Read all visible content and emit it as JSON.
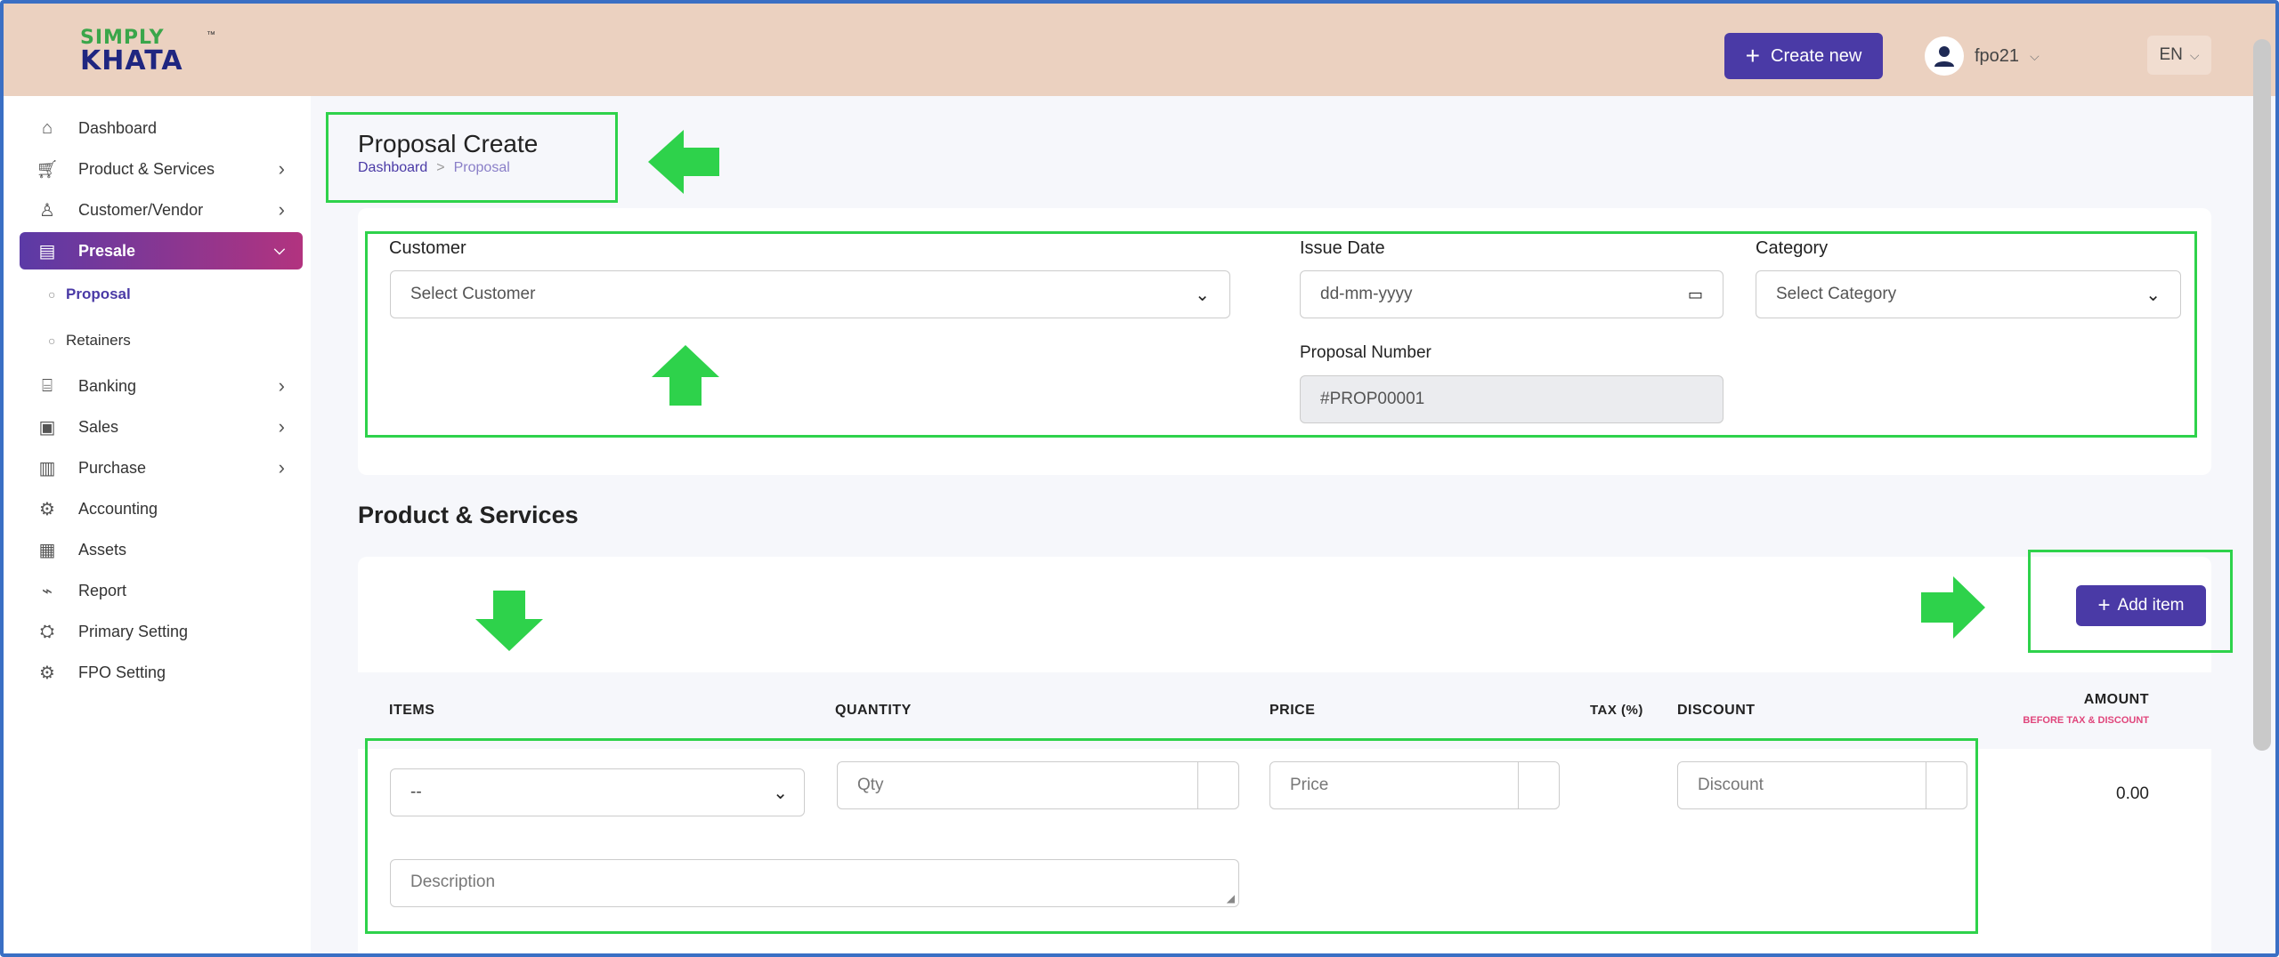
{
  "colors": {
    "header_bg": "#ebd1c0",
    "primary": "#4a3aa6",
    "active_gradient_start": "#5b3aa6",
    "active_gradient_end": "#b2337f",
    "annotation": "#2ed24b",
    "amount_sub": "#e0457b"
  },
  "brand": {
    "line1": "SIMPLY",
    "line2": "KHATA",
    "tm": "™"
  },
  "header": {
    "create_label": "Create new",
    "user_name": "fpo21",
    "language": "EN"
  },
  "sidebar": {
    "items": [
      {
        "label": "Dashboard",
        "icon": "home-icon",
        "has_arrow": false
      },
      {
        "label": "Product & Services",
        "icon": "cart-icon",
        "has_arrow": true
      },
      {
        "label": "Customer/Vendor",
        "icon": "user-add-icon",
        "has_arrow": true
      },
      {
        "label": "Presale",
        "icon": "presale-icon",
        "has_arrow": true,
        "active": true
      },
      {
        "label": "Banking",
        "icon": "bank-icon",
        "has_arrow": true
      },
      {
        "label": "Sales",
        "icon": "sales-icon",
        "has_arrow": true
      },
      {
        "label": "Purchase",
        "icon": "purchase-icon",
        "has_arrow": true
      },
      {
        "label": "Accounting",
        "icon": "accounting-icon",
        "has_arrow": false
      },
      {
        "label": "Assets",
        "icon": "assets-icon",
        "has_arrow": false
      },
      {
        "label": "Report",
        "icon": "report-icon",
        "has_arrow": false
      },
      {
        "label": "Primary Setting",
        "icon": "setting-icon",
        "has_arrow": false
      },
      {
        "label": "FPO Setting",
        "icon": "gear-icon",
        "has_arrow": false
      }
    ],
    "sub_items": [
      {
        "label": "Proposal",
        "current": true
      },
      {
        "label": "Retainers",
        "current": false
      }
    ]
  },
  "page": {
    "title": "Proposal Create",
    "breadcrumb": {
      "home": "Dashboard",
      "separator": ">",
      "current": "Proposal"
    }
  },
  "form": {
    "customer_label": "Customer",
    "customer_value": "Select Customer",
    "issue_date_label": "Issue Date",
    "issue_date_placeholder": "dd-mm-yyyy",
    "category_label": "Category",
    "category_value": "Select Category",
    "proposal_number_label": "Proposal Number",
    "proposal_number_value": "#PROP00001"
  },
  "products": {
    "section_title": "Product & Services",
    "add_item_label": "Add item",
    "headers": {
      "items": "ITEMS",
      "quantity": "QUANTITY",
      "price": "PRICE",
      "tax": "TAX (%)",
      "discount": "DISCOUNT",
      "amount": "AMOUNT",
      "amount_sub": "BEFORE TAX & DISCOUNT"
    },
    "row": {
      "item_value": "--",
      "qty_placeholder": "Qty",
      "price_placeholder": "Price",
      "discount_placeholder": "Discount",
      "amount": "0.00",
      "description_placeholder": "Description"
    }
  }
}
